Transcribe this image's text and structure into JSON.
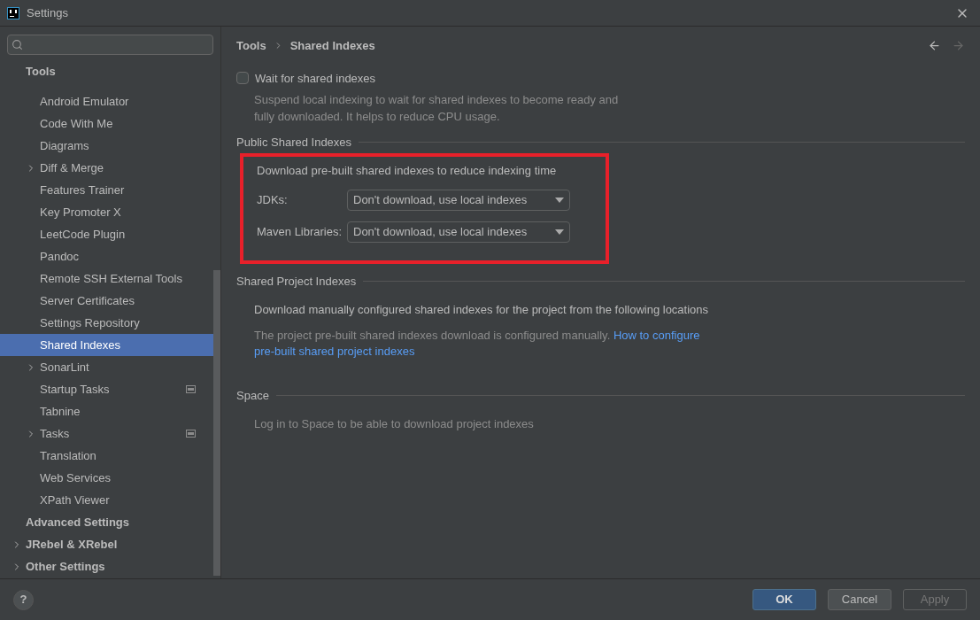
{
  "window": {
    "title": "Settings"
  },
  "help_button": {
    "label": "?"
  },
  "sidebar": {
    "items": [
      {
        "label": "Tools",
        "children": [
          {
            "label": "Android Emulator",
            "selected": false
          },
          {
            "label": "Code With Me",
            "selected": false
          },
          {
            "label": "Diagrams",
            "selected": false
          },
          {
            "label": "Diff & Merge",
            "selected": false,
            "expanded": false
          },
          {
            "label": "Features Trainer",
            "selected": false
          },
          {
            "label": "Key Promoter X",
            "selected": false
          },
          {
            "label": "LeetCode Plugin",
            "selected": false
          },
          {
            "label": "Pandoc",
            "selected": false
          },
          {
            "label": "Remote SSH External Tools",
            "selected": false
          },
          {
            "label": "Server Certificates",
            "selected": false
          },
          {
            "label": "Settings Repository",
            "selected": false
          },
          {
            "label": "Shared Indexes",
            "selected": true
          },
          {
            "label": "SonarLint",
            "selected": false,
            "expanded": false
          },
          {
            "label": "Startup Tasks",
            "selected": false,
            "project_level": true
          },
          {
            "label": "Tabnine",
            "selected": false
          },
          {
            "label": "Tasks",
            "selected": false,
            "expanded": false,
            "project_level": true
          },
          {
            "label": "Translation",
            "selected": false
          },
          {
            "label": "Web Services",
            "selected": false
          },
          {
            "label": "XPath Viewer",
            "selected": false
          }
        ]
      },
      {
        "label": "Advanced Settings",
        "selected": false
      },
      {
        "label": "JRebel & XRebel",
        "selected": false,
        "expanded": false
      },
      {
        "label": "Other Settings",
        "selected": false,
        "expanded": false
      }
    ]
  },
  "breadcrumb": [
    "Tools",
    "Shared Indexes"
  ],
  "wait_option": {
    "label": "Wait for shared indexes",
    "checked": false,
    "description": "Suspend local indexing to wait for shared indexes to become ready and fully downloaded. It helps to reduce CPU usage."
  },
  "public_section": {
    "title": "Public Shared Indexes",
    "highlighted": true,
    "intro": "Download pre-built shared indexes to reduce indexing time",
    "fields": [
      {
        "label": "JDKs:",
        "value": "Don't download, use local indexes"
      },
      {
        "label": "Maven Libraries:",
        "value": "Don't download, use local indexes"
      }
    ]
  },
  "project_section": {
    "title": "Shared Project Indexes",
    "intro": "Download manually configured shared indexes for the project from the following locations",
    "note": "The project pre-built shared indexes download is configured manually.",
    "link_lines": [
      "How to configure",
      "pre-built shared project indexes"
    ]
  },
  "space_section": {
    "title": "Space",
    "note": "Log in to Space to be able to download project indexes"
  },
  "buttons": [
    {
      "label": "OK",
      "kind": "primary"
    },
    {
      "label": "Cancel",
      "kind": "normal"
    },
    {
      "label": "Apply",
      "kind": "disabled"
    }
  ]
}
